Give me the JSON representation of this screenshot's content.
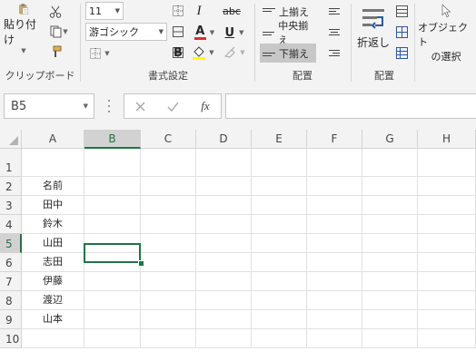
{
  "clipboard": {
    "paste_label": "貼り付け",
    "group_label": "クリップボード",
    "paste_icon": "clipboard-paste-icon",
    "cut_icon": "scissors-icon",
    "copy_icon": "copy-icon",
    "format_painter_icon": "paintbrush-icon"
  },
  "font": {
    "size": "11",
    "name": "游ゴシック",
    "group_label": "書式設定",
    "italic_label": "I",
    "strike_label": "abc",
    "bold_label": "B",
    "color_label": "A",
    "underline_label": "U",
    "font_color": "#d13438",
    "fill_color": "#ffff00"
  },
  "alignment": {
    "top_label": "上揃え",
    "middle_label": "中央揃え",
    "bottom_label": "下揃え",
    "group_label": "配置"
  },
  "wrap": {
    "label": "折返し",
    "group_label": "配置"
  },
  "select_objects": {
    "label_line1": "オブジェクト",
    "label_line2": "の選択"
  },
  "formula_bar": {
    "name_box": "B5",
    "value": "",
    "cancel_icon": "x-icon",
    "enter_icon": "check-icon",
    "fx_label": "fx"
  },
  "sheet": {
    "columns": [
      "A",
      "B",
      "C",
      "D",
      "E",
      "F",
      "G",
      "H"
    ],
    "selected_column": "B",
    "selected_row": "5",
    "rows": [
      {
        "num": "1",
        "a": ""
      },
      {
        "num": "2",
        "a": "名前"
      },
      {
        "num": "3",
        "a": "田中"
      },
      {
        "num": "4",
        "a": "鈴木"
      },
      {
        "num": "5",
        "a": "山田"
      },
      {
        "num": "6",
        "a": "志田"
      },
      {
        "num": "7",
        "a": "伊藤"
      },
      {
        "num": "8",
        "a": "渡辺"
      },
      {
        "num": "9",
        "a": "山本"
      },
      {
        "num": "10",
        "a": ""
      }
    ],
    "accent_color": "#217346"
  }
}
